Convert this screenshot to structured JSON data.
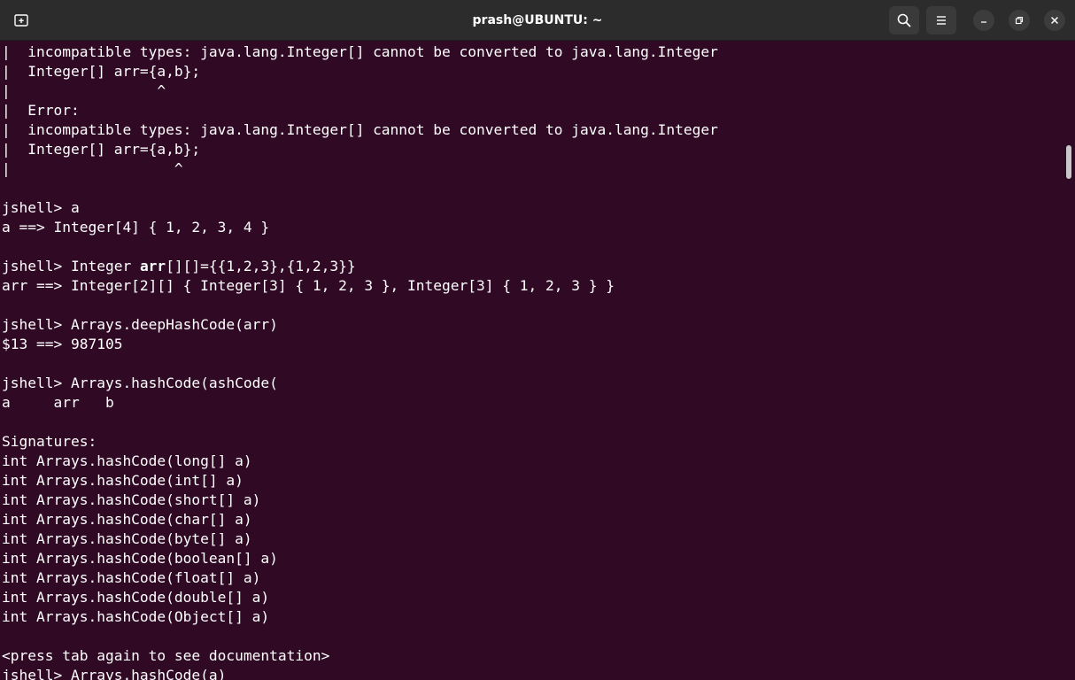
{
  "window": {
    "title": "prash@UBUNTU: ~"
  },
  "toolbar": {
    "new_tab_icon": "new-tab-icon",
    "search_icon": "search-icon",
    "menu_icon": "hamburger-menu-icon",
    "minimize_icon": "minimize-icon",
    "restore_icon": "restore-icon",
    "close_icon": "close-icon"
  },
  "colors": {
    "terminal_bg": "#300a24",
    "titlebar_bg": "#2c2c2c",
    "text": "#ffffff"
  },
  "terminal": {
    "lines": [
      "|  incompatible types: java.lang.Integer[] cannot be converted to java.lang.Integer",
      "|  Integer[] arr={a,b};",
      "|                 ^",
      "|  Error:",
      "|  incompatible types: java.lang.Integer[] cannot be converted to java.lang.Integer",
      "|  Integer[] arr={a,b};",
      "|                   ^",
      "",
      "jshell> a",
      "a ==> Integer[4] { 1, 2, 3, 4 }",
      "",
      "jshell> Integer arr[][]={{1,2,3},{1,2,3}}",
      "arr ==> Integer[2][] { Integer[3] { 1, 2, 3 }, Integer[3] { 1, 2, 3 } }",
      "",
      "jshell> Arrays.deepHashCode(arr)",
      "$13 ==> 987105",
      "",
      "jshell> Arrays.hashCode(ashCode(",
      "a     arr   b",
      "",
      "Signatures:",
      "int Arrays.hashCode(long[] a)",
      "int Arrays.hashCode(int[] a)",
      "int Arrays.hashCode(short[] a)",
      "int Arrays.hashCode(char[] a)",
      "int Arrays.hashCode(byte[] a)",
      "int Arrays.hashCode(boolean[] a)",
      "int Arrays.hashCode(float[] a)",
      "int Arrays.hashCode(double[] a)",
      "int Arrays.hashCode(Object[] a)",
      "",
      "<press tab again to see documentation>",
      "jshell> Arrays.hashCode(a)"
    ]
  }
}
